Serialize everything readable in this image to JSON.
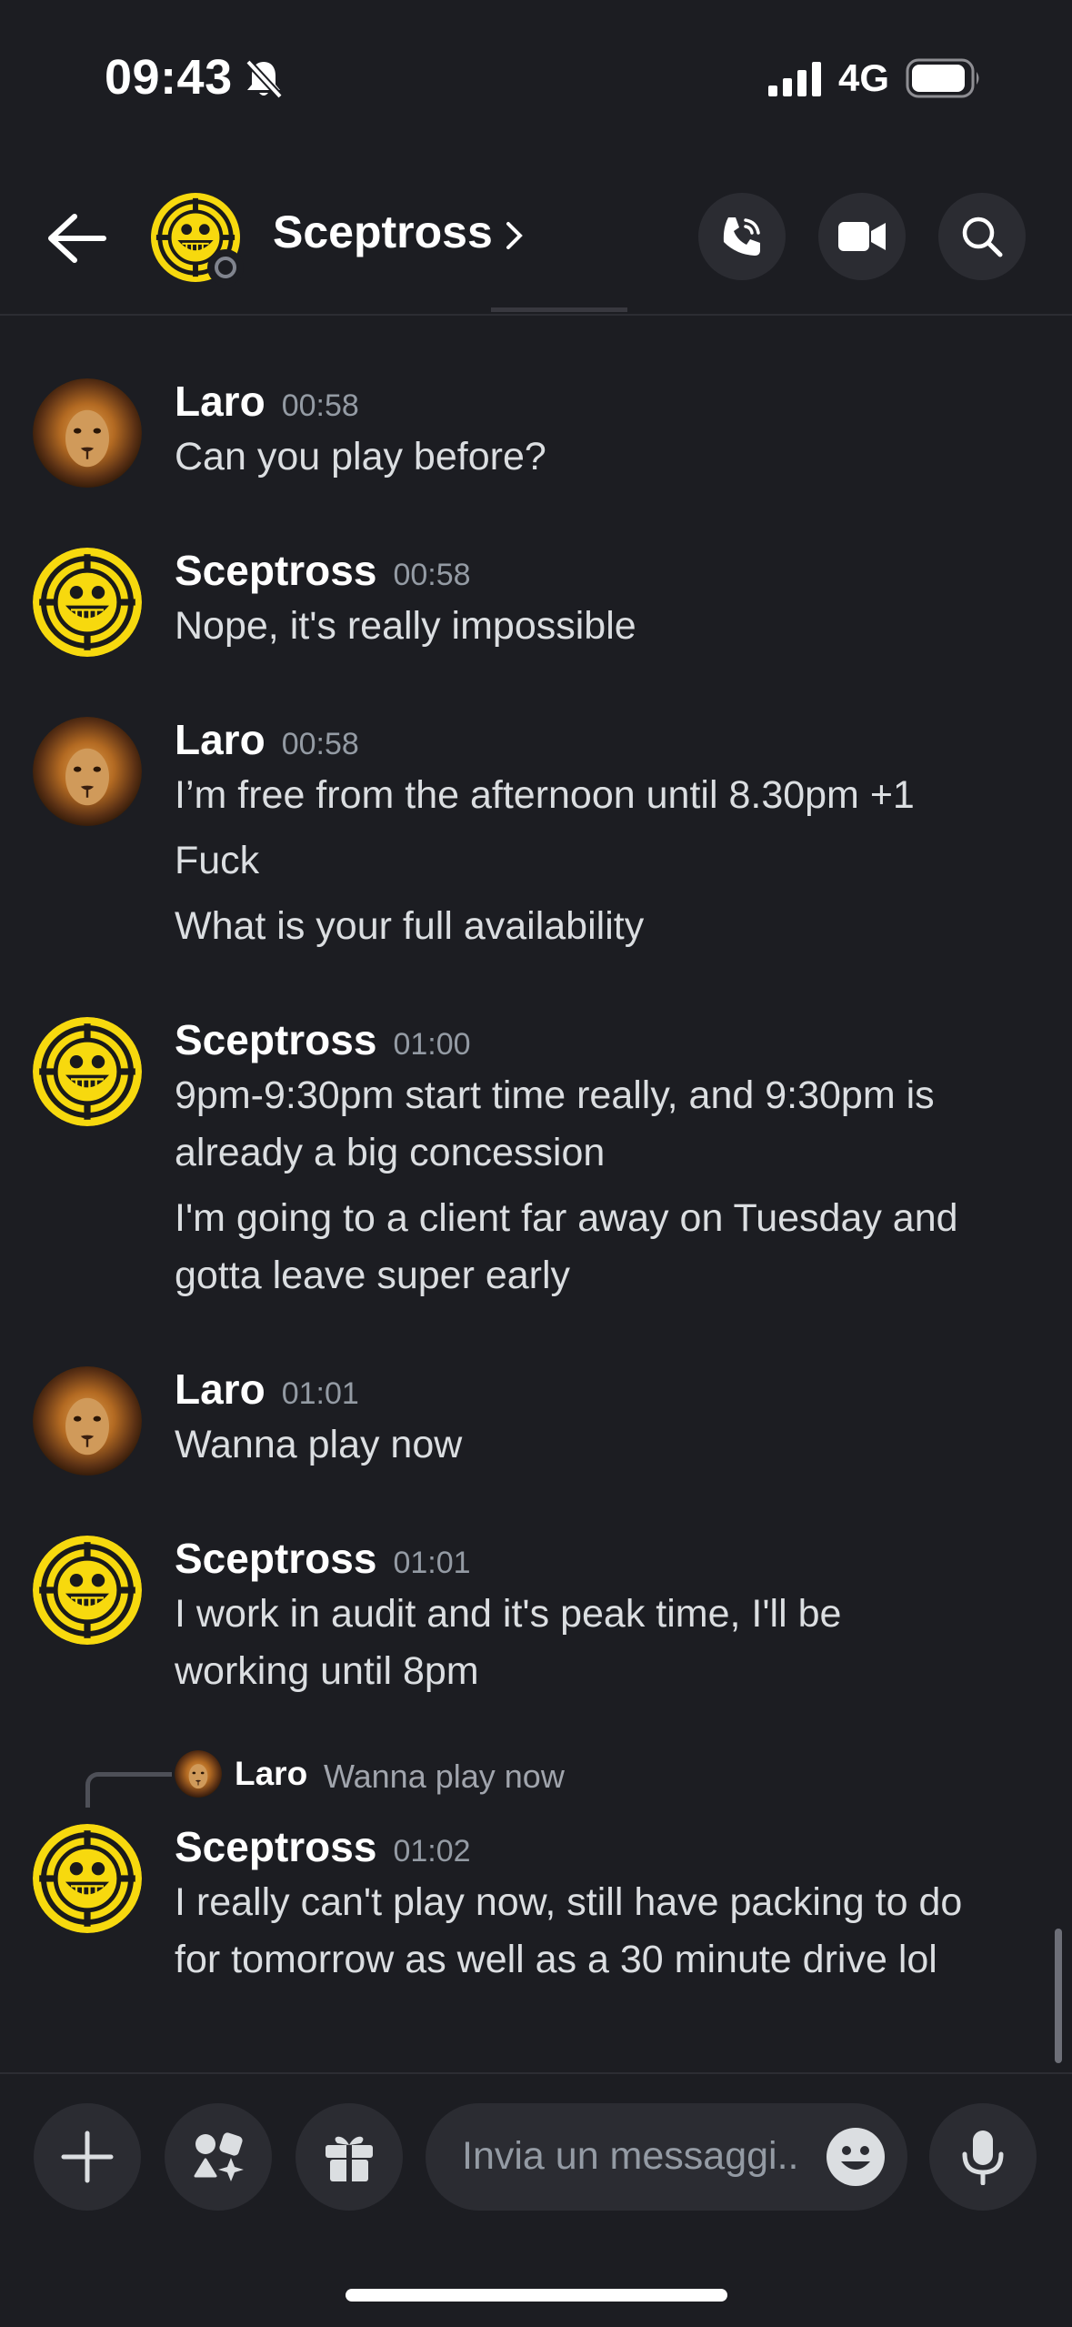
{
  "status_bar": {
    "time": "09:43",
    "network": "4G"
  },
  "header": {
    "channel_name": "Sceptross",
    "presence": "offline"
  },
  "messages": [
    {
      "author": "Laro",
      "time": "00:58",
      "lines": [
        "Can you play before?"
      ]
    },
    {
      "author": "Sceptross",
      "time": "00:58",
      "lines": [
        "Nope, it's really impossible"
      ]
    },
    {
      "author": "Laro",
      "time": "00:58",
      "lines": [
        "I’m free from the afternoon until 8.30pm +1",
        "Fuck",
        "What is your full availability"
      ]
    },
    {
      "author": "Sceptross",
      "time": "01:00",
      "lines": [
        "9pm-9:30pm start time really, and 9:30pm is",
        "already a big concession",
        "I'm going to a client far away on Tuesday and",
        "gotta leave super early"
      ]
    },
    {
      "author": "Laro",
      "time": "01:01",
      "lines": [
        "Wanna play now"
      ]
    },
    {
      "author": "Sceptross",
      "time": "01:01",
      "lines": [
        "I work in audit and it's peak time, I'll be",
        "working until 8pm"
      ]
    },
    {
      "author": "Sceptross",
      "time": "01:02",
      "reply_to": {
        "author": "Laro",
        "text": "Wanna play now"
      },
      "lines": [
        "I really can't play now, still have packing to do",
        "for tomorrow as well as a 30 minute drive lol"
      ]
    }
  ],
  "composer": {
    "placeholder": "Invia un messaggi.."
  },
  "icons": [
    "back-arrow-icon",
    "phone-call-icon",
    "video-camera-icon",
    "search-icon",
    "plus-icon",
    "apps-icon",
    "gift-icon",
    "emoji-icon",
    "microphone-icon",
    "bell-muted-icon"
  ],
  "colors": {
    "background": "#1c1d22",
    "button_bg": "#2b2c32",
    "muted_text": "#949ba4",
    "message_text": "#dbdee1",
    "avatar_yellow": "#f7d90e"
  }
}
